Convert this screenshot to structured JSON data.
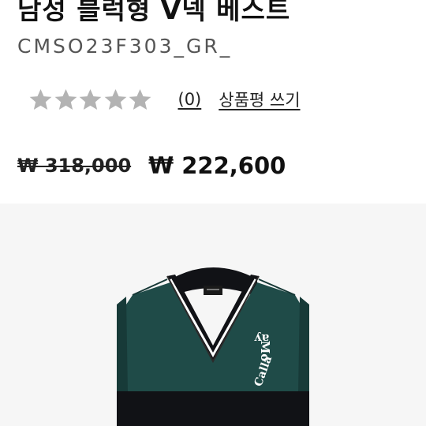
{
  "product": {
    "title": "남성 블럭형 V넥 베스트",
    "code": "CMSO23F303_GR_"
  },
  "rating": {
    "stars_filled": 0,
    "stars_total": 5,
    "review_count_label": "(0)",
    "write_review_label": "상품평 쓰기"
  },
  "price": {
    "original": "₩ 318,000",
    "sale": "₩ 222,600"
  },
  "colors": {
    "vest_green": "#1f4b48",
    "vest_black": "#111216",
    "rib_stripe": "#ffffff",
    "background_image": "#f6f6f6",
    "star_empty": "#b3b3b3"
  },
  "image": {
    "logo_lines": [
      "ay",
      "Mo",
      "Calla"
    ]
  }
}
